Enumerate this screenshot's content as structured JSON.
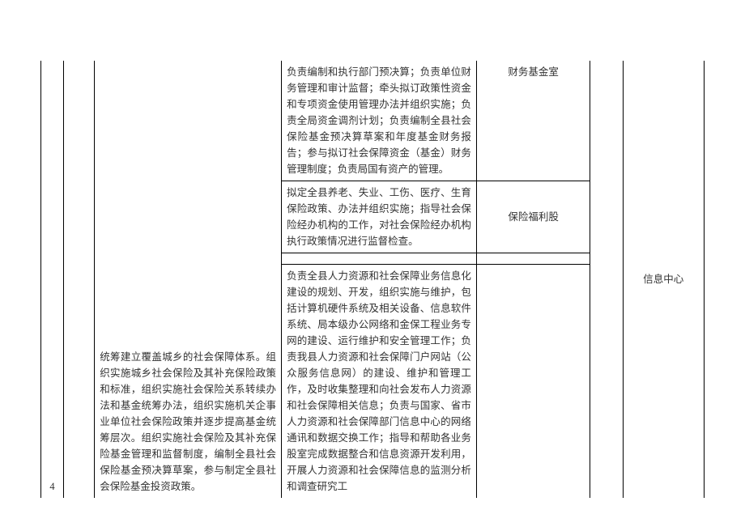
{
  "table": {
    "row_number": "4",
    "main_desc": "统筹建立覆盖城乡的社会保障体系。组织实施城乡社会保险及其补充保险政策和标准，组织实施社会保险关系转续办法和基金统筹办法，组织实施机关企事业单位社会保险政策并逐步提高基金统筹层次。组织实施社会保险及其补充保险基金管理和监督制度，编制全县社会保险基金预决算草案，参与制定全县社会保险基金投资政策。",
    "rows": [
      {
        "desc": "负责编制和执行部门预决算；负责单位财务管理和审计监督；牵头拟订政策性资金和专项资金使用管理办法并组织实施；负责全局资金调剂计划；负责编制全县社会保险基金预决算草案和年度基金财务报告；参与拟订社会保障资金（基金）财务管理制度；负责局国有资产的管理。",
        "dept": "财务基金室"
      },
      {
        "desc": "拟定全县养老、失业、工伤、医疗、生育保险政策、办法并组织实施；指导社会保险经办机构的工作，对社会保险经办机构执行政策情况进行监督检查。",
        "dept": "保险福利股"
      },
      {
        "desc": "负责全县人力资源和社会保障业务信息化建设的规划、开发，组织实施与维护，包括计算机硬件系统及相关设备、信息软件系统、局本级办公网络和金保工程业务专网的建设、运行维护和安全管理工作；负责我县人力资源和社会保障门户网站（公众服务信息网）的建设、维护和管理工作，及时收集整理和向社会发布人力资源和社会保障相关信息；负责与国家、省市人力资源和社会保障部门信息中心的网络通讯和数据交换工作；指导和帮助各业务股室完成数据整合和信息资源开发利用，开展人力资源和社会保障信息的监测分析和调查研究工",
        "dept": "信息中心"
      }
    ]
  }
}
